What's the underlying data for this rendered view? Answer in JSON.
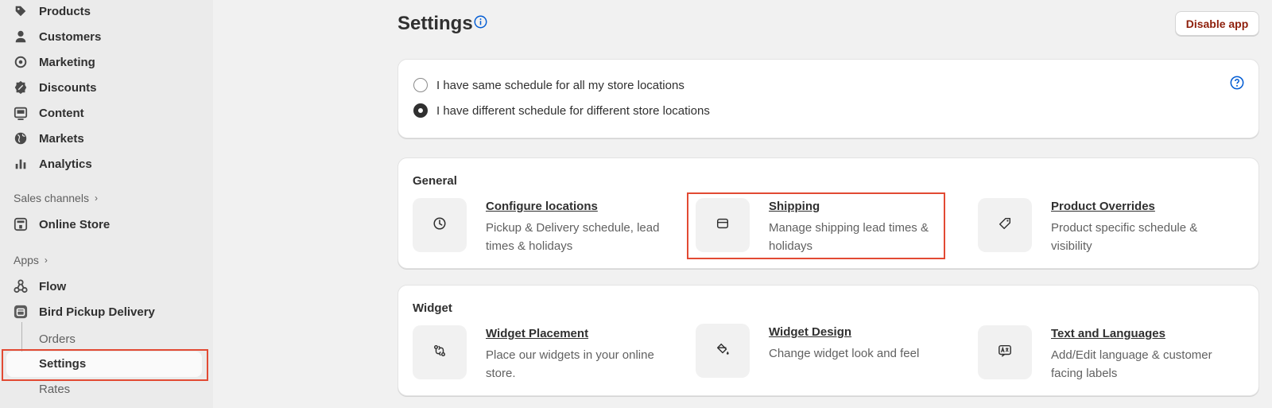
{
  "sidebar": {
    "items": [
      {
        "label": "Products",
        "icon": "tag-icon"
      },
      {
        "label": "Customers",
        "icon": "person-icon"
      },
      {
        "label": "Marketing",
        "icon": "target-icon"
      },
      {
        "label": "Discounts",
        "icon": "discount-icon"
      },
      {
        "label": "Content",
        "icon": "content-icon"
      },
      {
        "label": "Markets",
        "icon": "globe-icon"
      },
      {
        "label": "Analytics",
        "icon": "bar-chart-icon"
      }
    ],
    "sales_channels_label": "Sales channels",
    "online_store": "Online Store",
    "apps_label": "Apps",
    "flow": "Flow",
    "app_name": "Bird Pickup Delivery",
    "app_sub": [
      "Orders",
      "Settings",
      "Rates"
    ]
  },
  "header": {
    "title": "Settings",
    "disable_button": "Disable app"
  },
  "schedule": {
    "options": [
      {
        "label": "I have same schedule for all my store locations",
        "checked": false
      },
      {
        "label": "I have different schedule for different store locations",
        "checked": true
      }
    ]
  },
  "general": {
    "heading": "General",
    "features": [
      {
        "title": "Configure locations",
        "desc": "Pickup & Delivery schedule, lead times & holidays",
        "icon": "clock-icon"
      },
      {
        "title": "Shipping",
        "desc": "Manage shipping lead times & holidays",
        "icon": "package-icon"
      },
      {
        "title": "Product Overrides",
        "desc": "Product specific schedule & visibility",
        "icon": "tag-icon"
      }
    ]
  },
  "widget": {
    "heading": "Widget",
    "features": [
      {
        "title": "Widget Placement",
        "desc": "Place our widgets in your online store.",
        "icon": "arrows-swap-icon"
      },
      {
        "title": "Widget Design",
        "desc": "Change widget look and feel",
        "icon": "paint-bucket-icon"
      },
      {
        "title": "Text and Languages",
        "desc": "Add/Edit language & customer facing labels",
        "icon": "language-icon"
      }
    ]
  },
  "colors": {
    "highlight": "#e24a33",
    "accent_blue": "#005bd3",
    "danger_text": "#8e1f0b"
  }
}
